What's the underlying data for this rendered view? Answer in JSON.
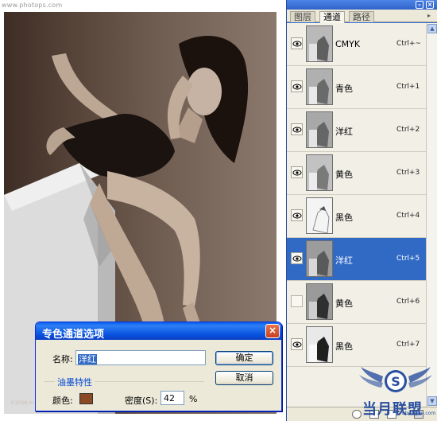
{
  "canvas": {
    "watermark": "www.photops.com",
    "credit": "©2006 m"
  },
  "panel": {
    "tabs": [
      "图层",
      "通道",
      "路径"
    ],
    "active_tab": "通道",
    "channels": [
      {
        "name": "CMYK",
        "shortcut": "Ctrl+~",
        "visible": true,
        "selected": false
      },
      {
        "name": "青色",
        "shortcut": "Ctrl+1",
        "visible": true,
        "selected": false
      },
      {
        "name": "洋红",
        "shortcut": "Ctrl+2",
        "visible": true,
        "selected": false
      },
      {
        "name": "黄色",
        "shortcut": "Ctrl+3",
        "visible": true,
        "selected": false
      },
      {
        "name": "黑色",
        "shortcut": "Ctrl+4",
        "visible": true,
        "selected": false
      },
      {
        "name": "洋红",
        "shortcut": "Ctrl+5",
        "visible": true,
        "selected": true
      },
      {
        "name": "黄色",
        "shortcut": "Ctrl+6",
        "visible": false,
        "selected": false
      },
      {
        "name": "黑色",
        "shortcut": "Ctrl+7",
        "visible": true,
        "selected": false
      }
    ]
  },
  "logo": {
    "text": "当月联盟",
    "url": "bbs.5yue.com"
  },
  "dialog": {
    "title": "专色通道选项",
    "name_label": "名称:",
    "name_value": "洋红",
    "ok_label": "确定",
    "cancel_label": "取消",
    "group_title": "油墨特性",
    "color_label": "颜色:",
    "color_value": "#8b4a26",
    "density_label": "密度(S):",
    "density_value": "42",
    "density_unit": "%"
  }
}
